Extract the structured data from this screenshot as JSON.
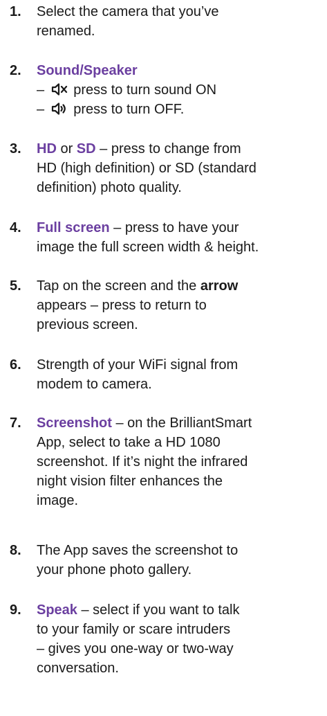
{
  "items": [
    {
      "number": "1.",
      "lines": [
        "Select the camera that you’ve",
        "renamed."
      ]
    },
    {
      "number": "2.",
      "title": "Sound/Speaker",
      "dash": "–",
      "mute_text": "press to turn sound ON",
      "unmute_text": "press to turn OFF.",
      "mute_icon": "speaker-muted-icon",
      "unmute_icon": "speaker-sound-icon"
    },
    {
      "number": "3.",
      "hd": "HD",
      "or": " or ",
      "sd": "SD",
      "l1_rest": " – press to change from",
      "l2": "HD (high definition) or SD (standard",
      "l3": "definition) photo quality."
    },
    {
      "number": "4.",
      "title": "Full screen",
      "l1_rest": " – press to have your",
      "l2": "image the full screen width & height."
    },
    {
      "number": "5.",
      "l1_start": "Tap on the screen and the ",
      "bold": "arrow",
      "l2": "appears – press to return to",
      "l3": "previous screen."
    },
    {
      "number": "6.",
      "lines": [
        "Strength of your WiFi signal from",
        "modem to camera."
      ]
    },
    {
      "number": "7.",
      "title": "Screenshot",
      "l1_rest": " – on the BrilliantSmart",
      "l2": "App, select to take a HD 1080",
      "l3": "screenshot. If it’s night the infrared",
      "l4": "night vision filter enhances the",
      "l5": "image."
    },
    {
      "number": "8.",
      "lines": [
        "The App saves the screenshot to",
        "your phone photo gallery."
      ]
    },
    {
      "number": "9.",
      "title": "Speak",
      "l1_rest": " – select if you want to talk",
      "l2": "to your family or scare intruders",
      "l3": "– gives you one-way or two-way",
      "l4": "conversation."
    }
  ],
  "colors": {
    "text": "#1a1a1a",
    "highlight": "#6b3fa0"
  }
}
